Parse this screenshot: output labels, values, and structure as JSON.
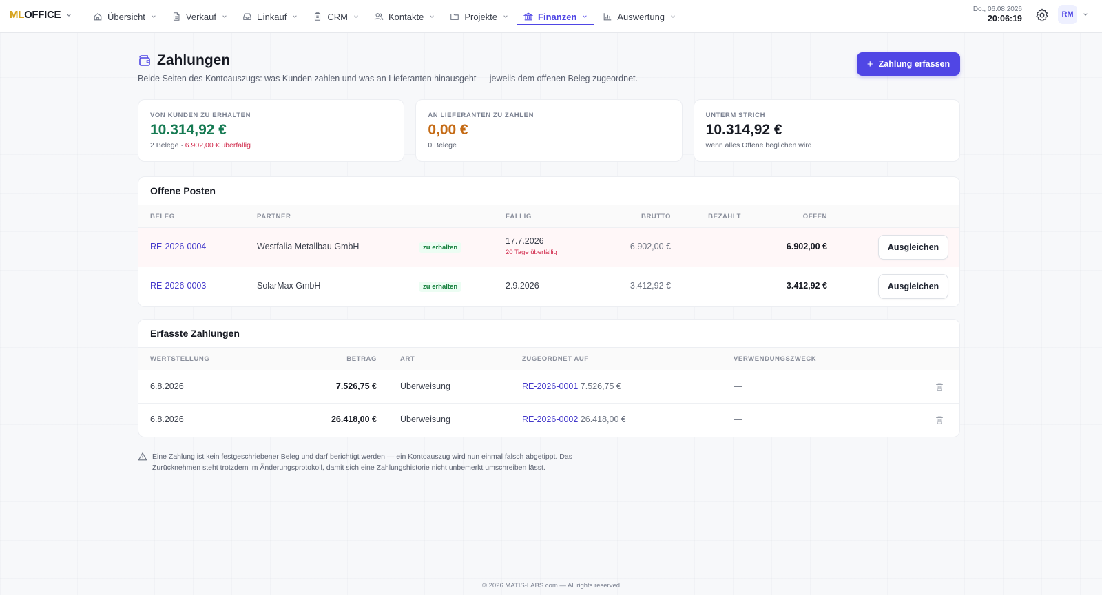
{
  "app": {
    "logo_ml": "ML",
    "logo_office": "OFFICE"
  },
  "nav": {
    "items": [
      {
        "label": "Übersicht",
        "icon": "home-icon"
      },
      {
        "label": "Verkauf",
        "icon": "document-icon"
      },
      {
        "label": "Einkauf",
        "icon": "inbox-icon"
      },
      {
        "label": "CRM",
        "icon": "clipboard-icon"
      },
      {
        "label": "Kontakte",
        "icon": "users-icon"
      },
      {
        "label": "Projekte",
        "icon": "folder-icon"
      },
      {
        "label": "Finanzen",
        "icon": "bank-icon",
        "active": true
      },
      {
        "label": "Auswertung",
        "icon": "bar-chart-icon"
      }
    ]
  },
  "header": {
    "date": "Do., 06.08.2026",
    "time": "20:06:19",
    "user_initials": "RM"
  },
  "page": {
    "title": "Zahlungen",
    "subtitle": "Beide Seiten des Kontoauszugs: was Kunden zahlen und was an Lieferanten hinausgeht — jeweils dem offenen Beleg zugeordnet.",
    "add_button": "Zahlung erfassen"
  },
  "stats": {
    "receivable": {
      "label": "VON KUNDEN ZU ERHALTEN",
      "value": "10.314,92 €",
      "note_count": "2 Belege · ",
      "note_overdue": "6.902,00 € überfällig"
    },
    "payable": {
      "label": "AN LIEFERANTEN ZU ZAHLEN",
      "value": "0,00 €",
      "note": "0 Belege"
    },
    "net": {
      "label": "UNTERM STRICH",
      "value": "10.314,92 €",
      "note": "wenn alles Offene beglichen wird"
    }
  },
  "open_items": {
    "title": "Offene Posten",
    "columns": {
      "beleg": "BELEG",
      "partner": "PARTNER",
      "faellig": "FÄLLIG",
      "brutto": "BRUTTO",
      "bezahlt": "BEZAHLT",
      "offen": "OFFEN"
    },
    "rows": [
      {
        "beleg": "RE-2026-0004",
        "partner": "Westfalia Metallbau GmbH",
        "status": "zu erhalten",
        "faellig": "17.7.2026",
        "overdue": "20 Tage überfällig",
        "brutto": "6.902,00 €",
        "bezahlt": "—",
        "offen": "6.902,00 €",
        "action": "Ausgleichen"
      },
      {
        "beleg": "RE-2026-0003",
        "partner": "SolarMax GmbH",
        "status": "zu erhalten",
        "faellig": "2.9.2026",
        "overdue": "",
        "brutto": "3.412,92 €",
        "bezahlt": "—",
        "offen": "3.412,92 €",
        "action": "Ausgleichen"
      }
    ]
  },
  "payments": {
    "title": "Erfasste Zahlungen",
    "columns": {
      "wertstellung": "WERTSTELLUNG",
      "betrag": "BETRAG",
      "art": "ART",
      "zugeordnet": "ZUGEORDNET AUF",
      "zweck": "VERWENDUNGSZWECK"
    },
    "rows": [
      {
        "wertstellung": "6.8.2026",
        "betrag": "7.526,75 €",
        "art": "Überweisung",
        "beleg": "RE-2026-0001",
        "beleg_betrag": "7.526,75 €",
        "zweck": "—"
      },
      {
        "wertstellung": "6.8.2026",
        "betrag": "26.418,00 €",
        "art": "Überweisung",
        "beleg": "RE-2026-0002",
        "beleg_betrag": "26.418,00 €",
        "zweck": "—"
      }
    ]
  },
  "notice": "Eine Zahlung ist kein festgeschriebener Beleg und darf berichtigt werden — ein Kontoauszug wird nun einmal falsch abgetippt. Das Zurücknehmen steht trotzdem im Änderungsprotokoll, damit sich eine Zahlungshistorie nicht unbemerkt umschreiben lässt.",
  "footer": "© 2026 MATIS-LABS.com — All rights reserved",
  "colors": {
    "accent": "#5046e5",
    "positive": "#157a52",
    "warning": "#c46a14",
    "danger": "#d12a4c"
  }
}
